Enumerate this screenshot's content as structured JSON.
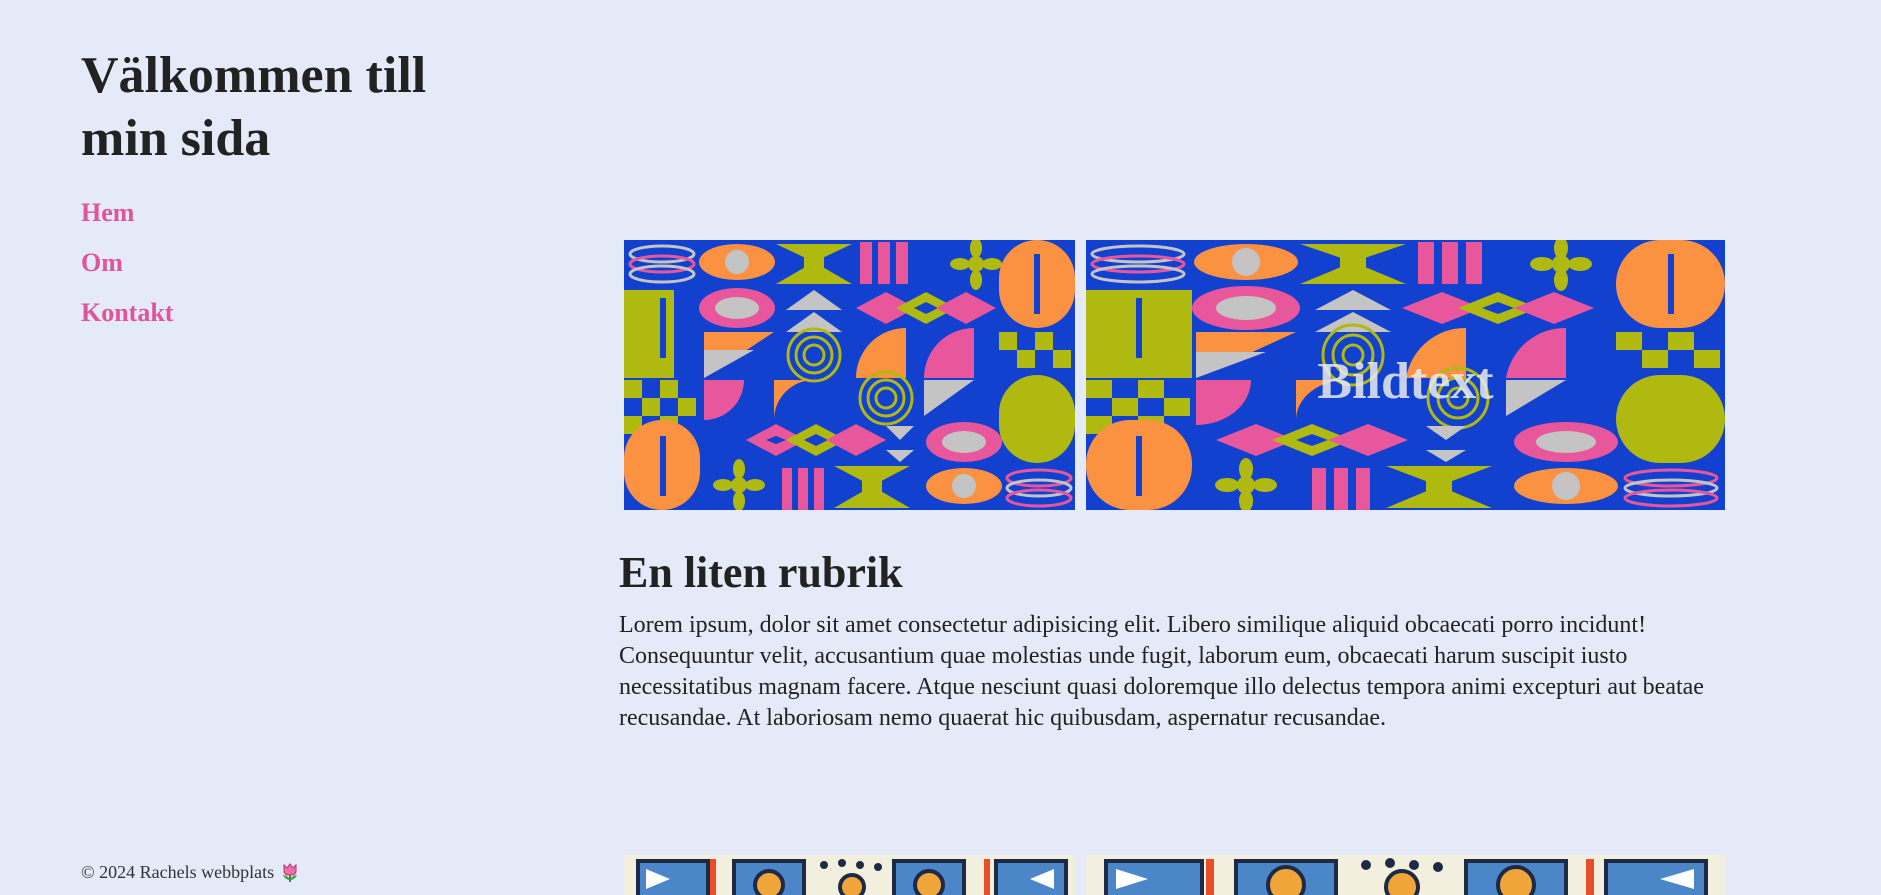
{
  "site": {
    "title": "Välkommen till min sida"
  },
  "nav": {
    "items": [
      {
        "label": "Hem"
      },
      {
        "label": "Om"
      },
      {
        "label": "Kontakt"
      }
    ]
  },
  "gallery": {
    "caption": "Bildtext"
  },
  "article": {
    "heading": "En liten rubrik",
    "body": "Lorem ipsum, dolor sit amet consectetur adipisicing elit. Libero similique aliquid obcaecati porro incidunt! Consequuntur velit, accusantium quae molestias unde fugit, laborum eum, obcaecati harum suscipit iusto necessitatibus magnam facere. Atque nesciunt quasi doloremque illo delectus tempora animi excepturi aut beatae recusandae. At laboriosam nemo quaerat hic quibusdam, aspernatur recusandae."
  },
  "footer": {
    "text": "© 2024 Rachels webbplats",
    "icon": "tulip-icon"
  },
  "colors": {
    "background": "#e4eaf8",
    "accent": "#e0559a",
    "pattern_blue": "#1240cf",
    "pattern_orange": "#fb9242",
    "pattern_pink": "#e8569c",
    "pattern_olive": "#b0b90f",
    "pattern_grey": "#c4c4c4"
  }
}
